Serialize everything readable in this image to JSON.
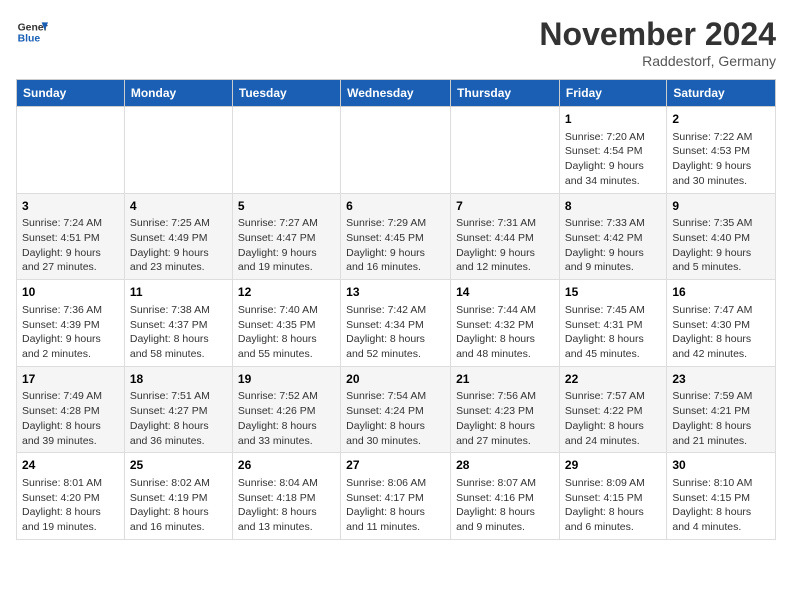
{
  "logo": {
    "line1": "General",
    "line2": "Blue"
  },
  "title": "November 2024",
  "location": "Raddestorf, Germany",
  "days_of_week": [
    "Sunday",
    "Monday",
    "Tuesday",
    "Wednesday",
    "Thursday",
    "Friday",
    "Saturday"
  ],
  "weeks": [
    [
      {
        "day": "",
        "info": ""
      },
      {
        "day": "",
        "info": ""
      },
      {
        "day": "",
        "info": ""
      },
      {
        "day": "",
        "info": ""
      },
      {
        "day": "",
        "info": ""
      },
      {
        "day": "1",
        "info": "Sunrise: 7:20 AM\nSunset: 4:54 PM\nDaylight: 9 hours and 34 minutes."
      },
      {
        "day": "2",
        "info": "Sunrise: 7:22 AM\nSunset: 4:53 PM\nDaylight: 9 hours and 30 minutes."
      }
    ],
    [
      {
        "day": "3",
        "info": "Sunrise: 7:24 AM\nSunset: 4:51 PM\nDaylight: 9 hours and 27 minutes."
      },
      {
        "day": "4",
        "info": "Sunrise: 7:25 AM\nSunset: 4:49 PM\nDaylight: 9 hours and 23 minutes."
      },
      {
        "day": "5",
        "info": "Sunrise: 7:27 AM\nSunset: 4:47 PM\nDaylight: 9 hours and 19 minutes."
      },
      {
        "day": "6",
        "info": "Sunrise: 7:29 AM\nSunset: 4:45 PM\nDaylight: 9 hours and 16 minutes."
      },
      {
        "day": "7",
        "info": "Sunrise: 7:31 AM\nSunset: 4:44 PM\nDaylight: 9 hours and 12 minutes."
      },
      {
        "day": "8",
        "info": "Sunrise: 7:33 AM\nSunset: 4:42 PM\nDaylight: 9 hours and 9 minutes."
      },
      {
        "day": "9",
        "info": "Sunrise: 7:35 AM\nSunset: 4:40 PM\nDaylight: 9 hours and 5 minutes."
      }
    ],
    [
      {
        "day": "10",
        "info": "Sunrise: 7:36 AM\nSunset: 4:39 PM\nDaylight: 9 hours and 2 minutes."
      },
      {
        "day": "11",
        "info": "Sunrise: 7:38 AM\nSunset: 4:37 PM\nDaylight: 8 hours and 58 minutes."
      },
      {
        "day": "12",
        "info": "Sunrise: 7:40 AM\nSunset: 4:35 PM\nDaylight: 8 hours and 55 minutes."
      },
      {
        "day": "13",
        "info": "Sunrise: 7:42 AM\nSunset: 4:34 PM\nDaylight: 8 hours and 52 minutes."
      },
      {
        "day": "14",
        "info": "Sunrise: 7:44 AM\nSunset: 4:32 PM\nDaylight: 8 hours and 48 minutes."
      },
      {
        "day": "15",
        "info": "Sunrise: 7:45 AM\nSunset: 4:31 PM\nDaylight: 8 hours and 45 minutes."
      },
      {
        "day": "16",
        "info": "Sunrise: 7:47 AM\nSunset: 4:30 PM\nDaylight: 8 hours and 42 minutes."
      }
    ],
    [
      {
        "day": "17",
        "info": "Sunrise: 7:49 AM\nSunset: 4:28 PM\nDaylight: 8 hours and 39 minutes."
      },
      {
        "day": "18",
        "info": "Sunrise: 7:51 AM\nSunset: 4:27 PM\nDaylight: 8 hours and 36 minutes."
      },
      {
        "day": "19",
        "info": "Sunrise: 7:52 AM\nSunset: 4:26 PM\nDaylight: 8 hours and 33 minutes."
      },
      {
        "day": "20",
        "info": "Sunrise: 7:54 AM\nSunset: 4:24 PM\nDaylight: 8 hours and 30 minutes."
      },
      {
        "day": "21",
        "info": "Sunrise: 7:56 AM\nSunset: 4:23 PM\nDaylight: 8 hours and 27 minutes."
      },
      {
        "day": "22",
        "info": "Sunrise: 7:57 AM\nSunset: 4:22 PM\nDaylight: 8 hours and 24 minutes."
      },
      {
        "day": "23",
        "info": "Sunrise: 7:59 AM\nSunset: 4:21 PM\nDaylight: 8 hours and 21 minutes."
      }
    ],
    [
      {
        "day": "24",
        "info": "Sunrise: 8:01 AM\nSunset: 4:20 PM\nDaylight: 8 hours and 19 minutes."
      },
      {
        "day": "25",
        "info": "Sunrise: 8:02 AM\nSunset: 4:19 PM\nDaylight: 8 hours and 16 minutes."
      },
      {
        "day": "26",
        "info": "Sunrise: 8:04 AM\nSunset: 4:18 PM\nDaylight: 8 hours and 13 minutes."
      },
      {
        "day": "27",
        "info": "Sunrise: 8:06 AM\nSunset: 4:17 PM\nDaylight: 8 hours and 11 minutes."
      },
      {
        "day": "28",
        "info": "Sunrise: 8:07 AM\nSunset: 4:16 PM\nDaylight: 8 hours and 9 minutes."
      },
      {
        "day": "29",
        "info": "Sunrise: 8:09 AM\nSunset: 4:15 PM\nDaylight: 8 hours and 6 minutes."
      },
      {
        "day": "30",
        "info": "Sunrise: 8:10 AM\nSunset: 4:15 PM\nDaylight: 8 hours and 4 minutes."
      }
    ]
  ]
}
